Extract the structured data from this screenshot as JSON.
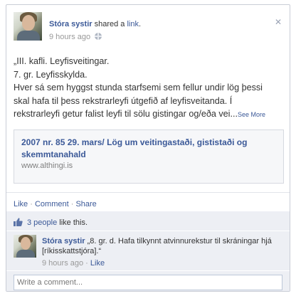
{
  "post": {
    "author": "Stóra systir",
    "action_text": " shared a ",
    "action_link": "link",
    "action_end": ".",
    "time": "9 hours ago",
    "privacy_icon": "globe-icon",
    "close_icon": "close-icon",
    "body_lines": [
      "„III. kafli. Leyfisveitingar.",
      "7. gr. Leyfisskylda.",
      "Hver sá sem hyggst stunda starfsemi sem fellur undir lög þessi",
      "skal hafa til þess rekstrarleyfi útgefið af leyfisveitanda. Í",
      "rekstrarleyfi getur falist leyfi til sölu gistingar og/eða vei..."
    ],
    "see_more": "See More"
  },
  "attachment": {
    "title": "2007 nr. 85 29. mars/ Lög um veitingastaði, gististaði og skemmtanahald",
    "url": "www.althingi.is"
  },
  "actions": {
    "like": "Like",
    "comment": "Comment",
    "share": "Share",
    "separator": " · "
  },
  "likes": {
    "icon": "thumbs-up-icon",
    "count_link": "3 people",
    "suffix": " like this."
  },
  "comment": {
    "author": "Stóra systir",
    "text": " „8. gr. d. Hafa tilkynnt atvinnurekstur til skráningar hjá [ríkisskattstjóra].“",
    "time": "9 hours ago",
    "separator": " · ",
    "like": "Like"
  },
  "composer": {
    "placeholder": "Write a comment..."
  },
  "colors": {
    "link": "#3b5998",
    "feedback_bg": "#edeff4",
    "border": "#c9cdd6"
  }
}
